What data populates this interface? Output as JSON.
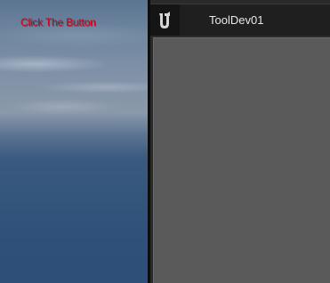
{
  "viewport": {
    "hud_text": "Click The Button",
    "hud_text_color": "#d8001a"
  },
  "editor_window": {
    "logo_icon": "unreal-engine-logo-icon",
    "tab_label": "ToolDev01",
    "panel_color": "#5a5a5a",
    "titlebar_color": "#151515"
  }
}
